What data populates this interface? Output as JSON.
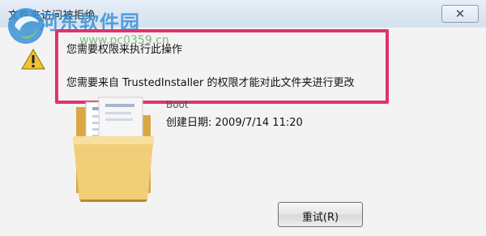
{
  "window": {
    "title": "文件夹访问被拒绝",
    "close_glyph": "✕"
  },
  "watermark": {
    "brand": "河东软件园",
    "url": "www.pc0359.cn"
  },
  "message": {
    "line1": "您需要权限来执行此操作",
    "line2": "您需要来自 TrustedInstaller 的权限才能对此文件夹进行更改"
  },
  "folder": {
    "name": "Boot",
    "date": "创建日期: 2009/7/14 11:20"
  },
  "buttons": {
    "retry": "重试(R)"
  },
  "colors": {
    "highlight": "#e0336b",
    "titlebar": "#d3e0ef",
    "watermark_blue": "#3a92d4",
    "watermark_green": "#4aa34a"
  },
  "icons": {
    "warning": "warning-icon",
    "folder": "folder-icon",
    "close": "close-icon",
    "watermark": "watermark-logo-icon"
  }
}
